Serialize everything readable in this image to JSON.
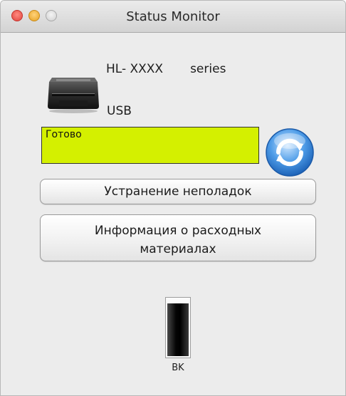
{
  "window": {
    "title": "Status Monitor"
  },
  "device": {
    "model": "HL- XXXX",
    "series": "series",
    "interface": "USB",
    "icon": "printer-icon"
  },
  "status": {
    "text": "Готово",
    "color": "#d4f000"
  },
  "buttons": {
    "troubleshoot": "Устранение неполадок",
    "supplies_line1": "Информация о расходных",
    "supplies_line2": "материалах",
    "refresh_icon": "refresh-icon"
  },
  "toner": {
    "label": "BK",
    "level": 0.93
  }
}
